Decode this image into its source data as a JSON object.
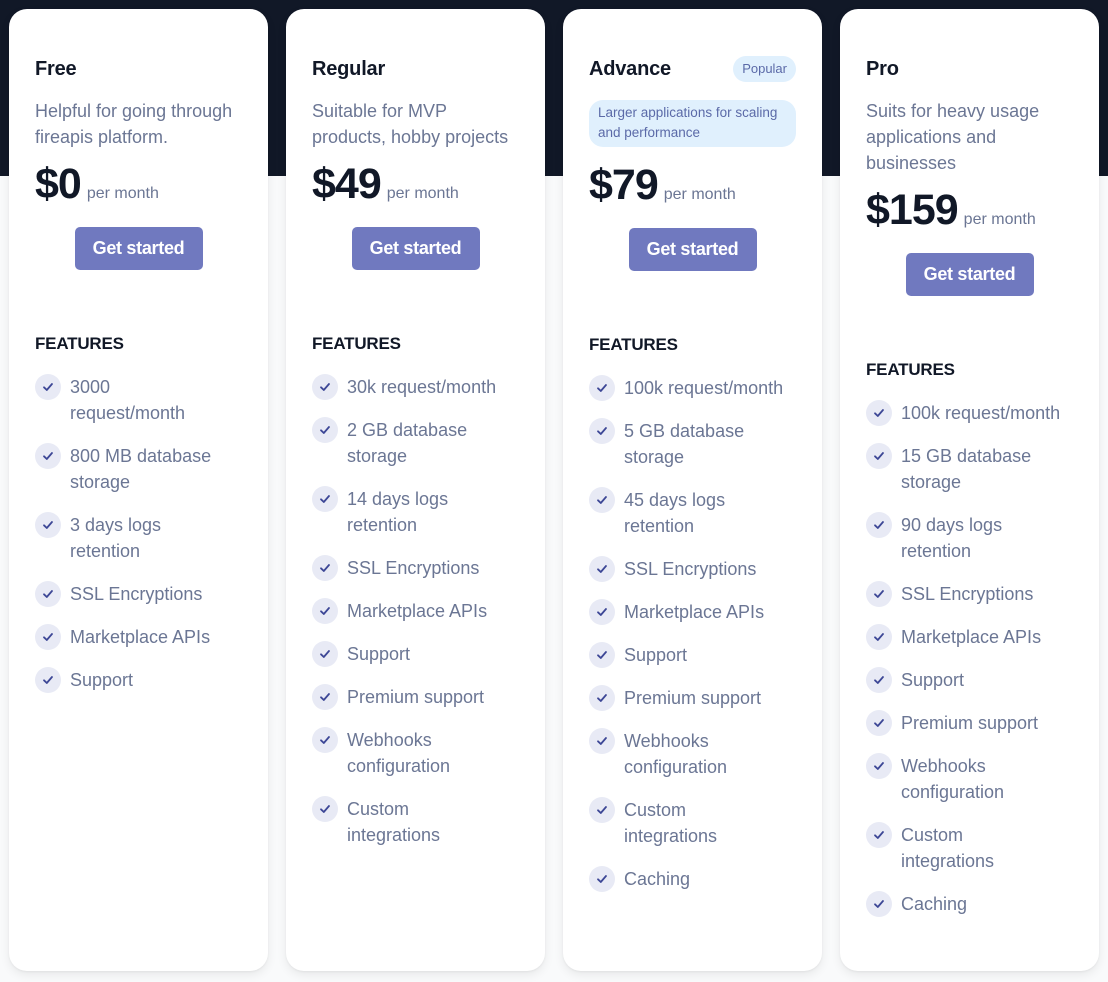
{
  "plans": [
    {
      "name": "Free",
      "badge": null,
      "description": "Helpful for going through fireapis platform.",
      "price": "$0",
      "period": "per month",
      "cta": "Get started",
      "features_title": "FEATURES",
      "features": [
        "3000 request/month",
        "800 MB database storage",
        "3 days logs retention",
        "SSL Encryptions",
        "Marketplace APIs",
        "Support"
      ]
    },
    {
      "name": "Regular",
      "badge": null,
      "description": "Suitable for MVP products, hobby projects",
      "price": "$49",
      "period": "per month",
      "cta": "Get started",
      "features_title": "FEATURES",
      "features": [
        "30k request/month",
        "2 GB database storage",
        "14 days logs retention",
        "SSL Encryptions",
        "Marketplace APIs",
        "Support",
        "Premium support",
        "Webhooks configuration",
        "Custom integrations"
      ]
    },
    {
      "name": "Advance",
      "badge": "Popular",
      "description": "Larger applications for scaling and performance",
      "price": "$79",
      "period": "per month",
      "cta": "Get started",
      "features_title": "FEATURES",
      "features": [
        "100k request/month",
        "5 GB database storage",
        "45 days logs retention",
        "SSL Encryptions",
        "Marketplace APIs",
        "Support",
        "Premium support",
        "Webhooks configuration",
        "Custom integrations",
        "Caching"
      ]
    },
    {
      "name": "Pro",
      "badge": null,
      "description": "Suits for heavy usage applications and businesses",
      "price": "$159",
      "period": "per month",
      "cta": "Get started",
      "features_title": "FEATURES",
      "features": [
        "100k request/month",
        "15 GB database storage",
        "90 days logs retention",
        "SSL Encryptions",
        "Marketplace APIs",
        "Support",
        "Premium support",
        "Webhooks configuration",
        "Custom integrations",
        "Caching"
      ]
    }
  ],
  "icons": {
    "feature_check": "check-icon"
  },
  "colors": {
    "hero": "#111827",
    "button": "#7079bf",
    "highlight": "#e0f0fd",
    "text_muted": "#6b7694"
  }
}
